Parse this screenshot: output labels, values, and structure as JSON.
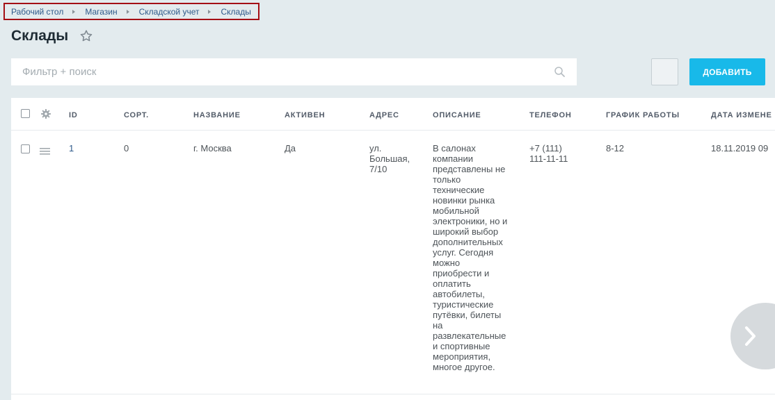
{
  "breadcrumb": {
    "items": [
      "Рабочий стол",
      "Магазин",
      "Складской учет",
      "Склады"
    ]
  },
  "page": {
    "title": "Склады"
  },
  "filter": {
    "placeholder": "Фильтр + поиск"
  },
  "toolbar": {
    "add_label": "ДОБАВИТЬ"
  },
  "table": {
    "columns": [
      "ID",
      "СОРТ.",
      "НАЗВАНИЕ",
      "АКТИВЕН",
      "АДРЕС",
      "ОПИСАНИЕ",
      "ТЕЛЕФОН",
      "ГРАФИК РАБОТЫ",
      "ДАТА ИЗМЕНЕ"
    ],
    "rows": [
      {
        "id": "1",
        "sort": "0",
        "name": "г. Москва",
        "active": "Да",
        "address": "ул. Большая, 7/10",
        "description": "В салонах компании представлены не только технические новинки рынка мобильной электроники, но и широкий выбор дополнительных услуг. Сегодня можно приобрести и оплатить автобилеты, туристические путёвки, билеты на развлекательные и спортивные мероприятия, многое другое.",
        "phone": "+7 (111) 111-11-11",
        "schedule": "8-12",
        "modified": "18.11.2019 09"
      }
    ]
  },
  "colors": {
    "accent": "#18b9e9",
    "link": "#2f5a8a",
    "highlight_border": "#a40f15",
    "background": "#e3ebee"
  },
  "icons": [
    "star-icon",
    "search-icon",
    "gear-icon",
    "drag-handle-icon",
    "chevron-right-icon"
  ]
}
